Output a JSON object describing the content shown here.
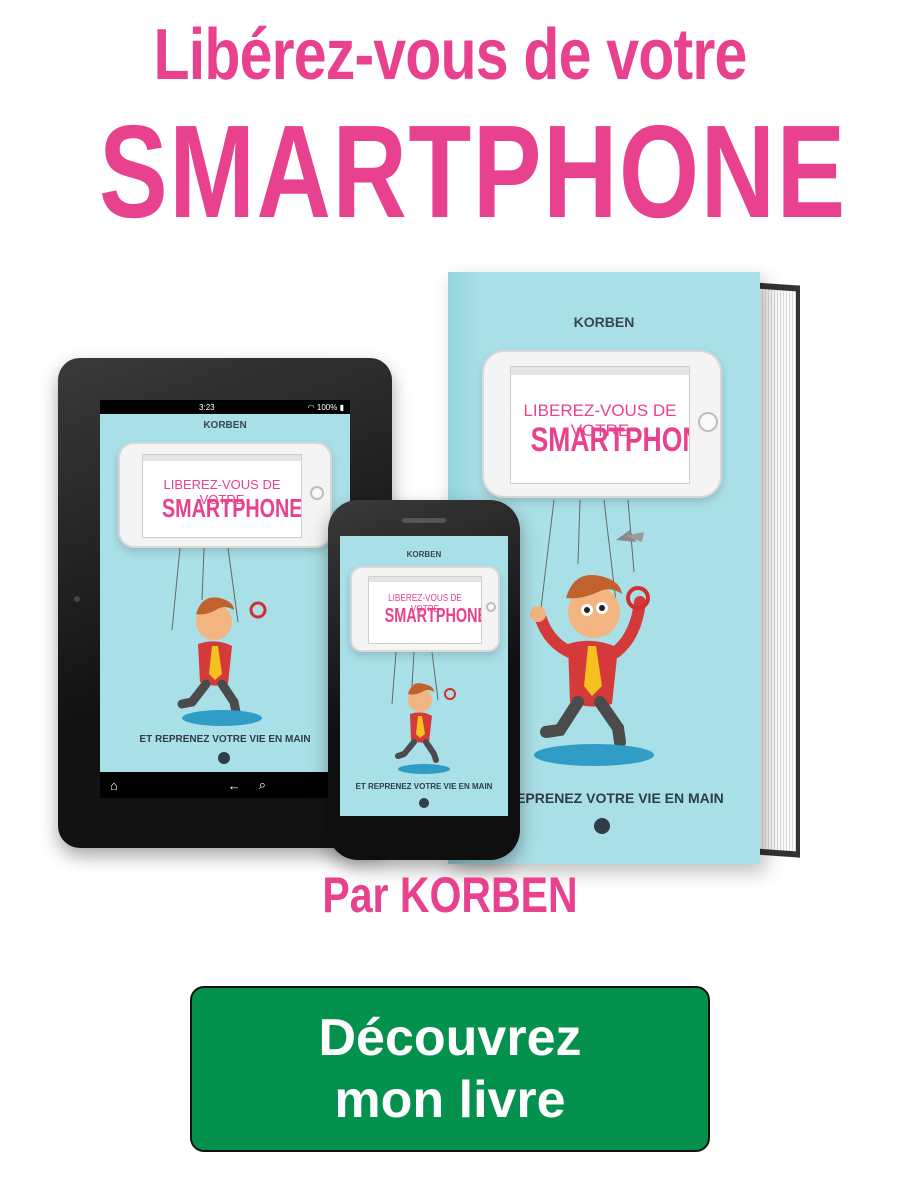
{
  "headline": {
    "line1": "Libérez-vous de votre",
    "line2": "SMARTPHONE"
  },
  "book_cover": {
    "author": "KORBEN",
    "title_line1": "LIBEREZ-VOUS DE VOTRE",
    "title_line2": "SMARTPHONE",
    "tagline": "ET REPRENEZ VOTRE VIE EN MAIN"
  },
  "tablet": {
    "time": "3:23",
    "battery": "100%"
  },
  "byline": "Par KORBEN",
  "cta": {
    "line1": "Découvrez",
    "line2": "mon livre"
  },
  "colors": {
    "brand_pink": "#e8418e",
    "cover_blue": "#a9dfe6",
    "cta_green": "#04904d"
  },
  "icons": [
    "home-icon",
    "back-arrow-icon",
    "search-icon",
    "wifi-icon",
    "battery-icon"
  ]
}
